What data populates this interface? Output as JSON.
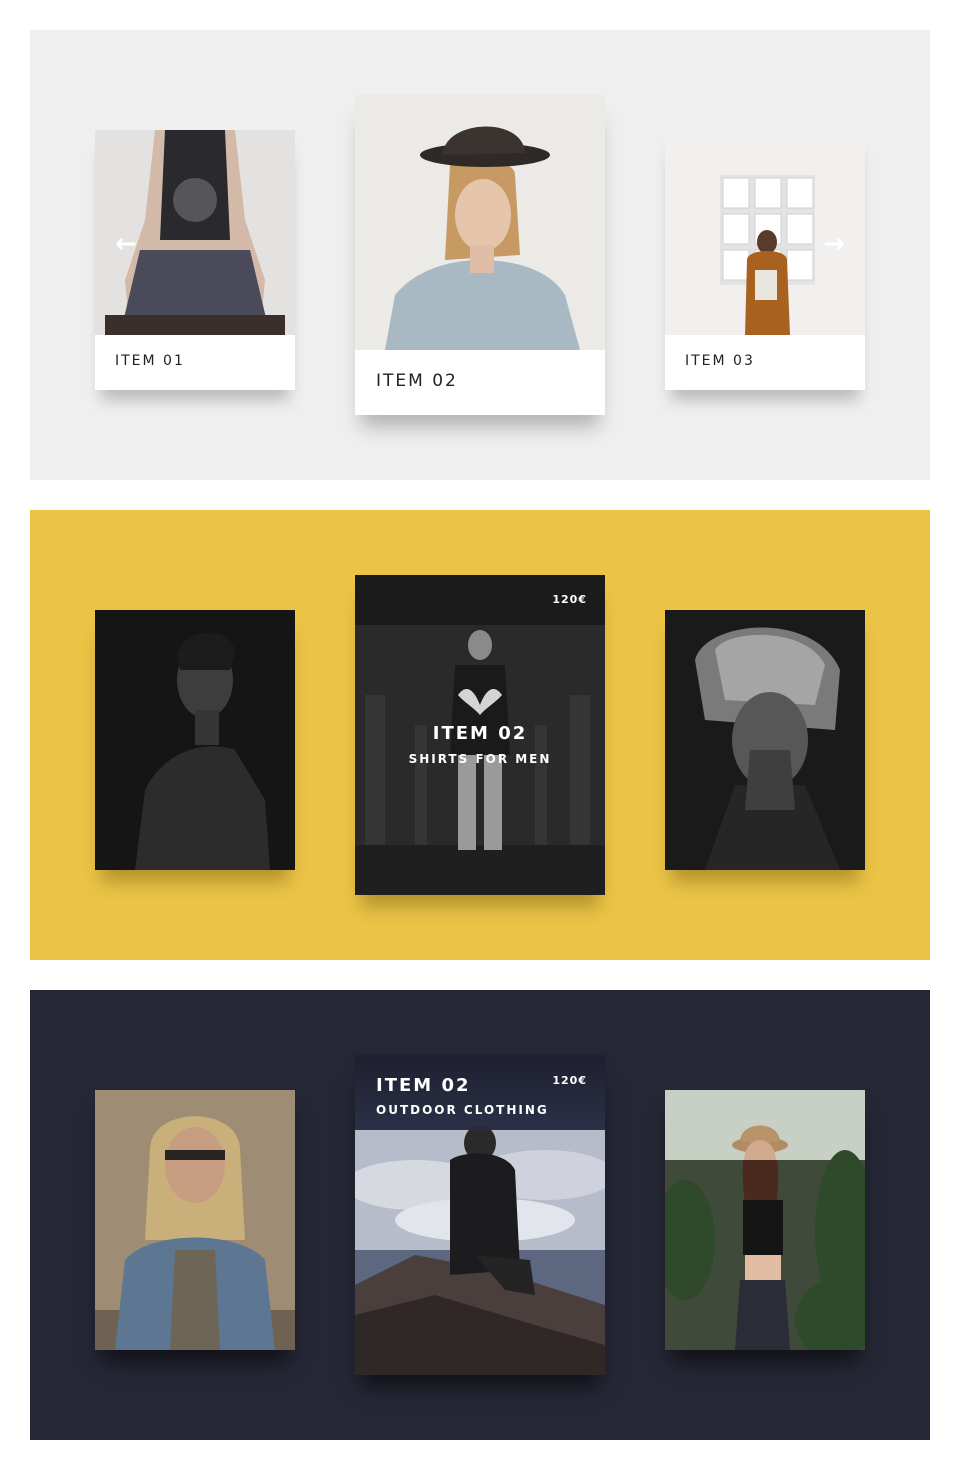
{
  "panel1": {
    "theme": "light",
    "background": "#efefef",
    "cards": [
      {
        "title": "ITEM 01"
      },
      {
        "title": "ITEM 02"
      },
      {
        "title": "ITEM 03"
      }
    ],
    "prev_icon": "arrow-left-icon",
    "next_icon": "arrow-right-icon"
  },
  "panel2": {
    "theme": "yellow",
    "background": "#ebc446",
    "featured": {
      "title": "ITEM 02",
      "subtitle": "SHIRTS FOR MEN",
      "price": "120€"
    }
  },
  "panel3": {
    "theme": "dark",
    "background": "#262735",
    "featured": {
      "title": "ITEM 02",
      "subtitle": "OUTDOOR CLOTHING",
      "price": "120€"
    }
  }
}
